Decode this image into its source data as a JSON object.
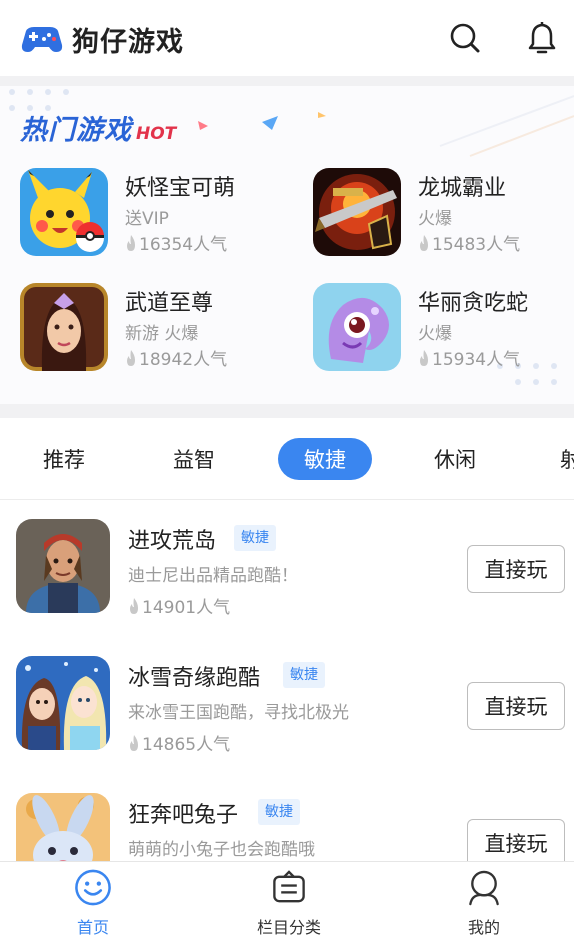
{
  "header": {
    "title": "狗仔游戏",
    "search_icon": "search-icon",
    "bell_icon": "bell-icon"
  },
  "hot": {
    "title_cn": "热门游戏",
    "title_en": "HOT",
    "games": [
      {
        "name": "妖怪宝可萌",
        "tag": "送VIP",
        "popularity": "16354人气",
        "icon": "pikachu"
      },
      {
        "name": "龙城霸业",
        "tag": "火爆",
        "popularity": "15483人气",
        "icon": "dragon-city"
      },
      {
        "name": "武道至尊",
        "tag": "新游 火爆",
        "popularity": "18942人气",
        "icon": "martial"
      },
      {
        "name": "华丽贪吃蛇",
        "tag": "火爆",
        "popularity": "15934人气",
        "icon": "snake"
      }
    ]
  },
  "tabs": [
    "推荐",
    "益智",
    "敏捷",
    "休闲",
    "射"
  ],
  "active_tab": "敏捷",
  "list": [
    {
      "name": "进攻荒岛",
      "badge": "敏捷",
      "desc": "迪士尼出品精品跑酷！",
      "popularity": "14901人气",
      "button": "直接玩"
    },
    {
      "name": "冰雪奇缘跑酷",
      "badge": "敏捷",
      "desc": "来冰雪王国跑酷，寻找北极光",
      "popularity": "14865人气",
      "button": "直接玩"
    },
    {
      "name": "狂奔吧兔子",
      "badge": "敏捷",
      "desc": "萌萌的小兔子也会跑酷哦",
      "popularity": "",
      "button": "直接玩"
    }
  ],
  "nav": [
    {
      "label": "首页",
      "icon": "smile-icon",
      "active": true
    },
    {
      "label": "栏目分类",
      "icon": "category-icon",
      "active": false
    },
    {
      "label": "我的",
      "icon": "user-icon",
      "active": false
    }
  ],
  "colors": {
    "accent": "#3a86f0",
    "hot_red": "#e2334b",
    "muted": "#9a9a9a"
  }
}
